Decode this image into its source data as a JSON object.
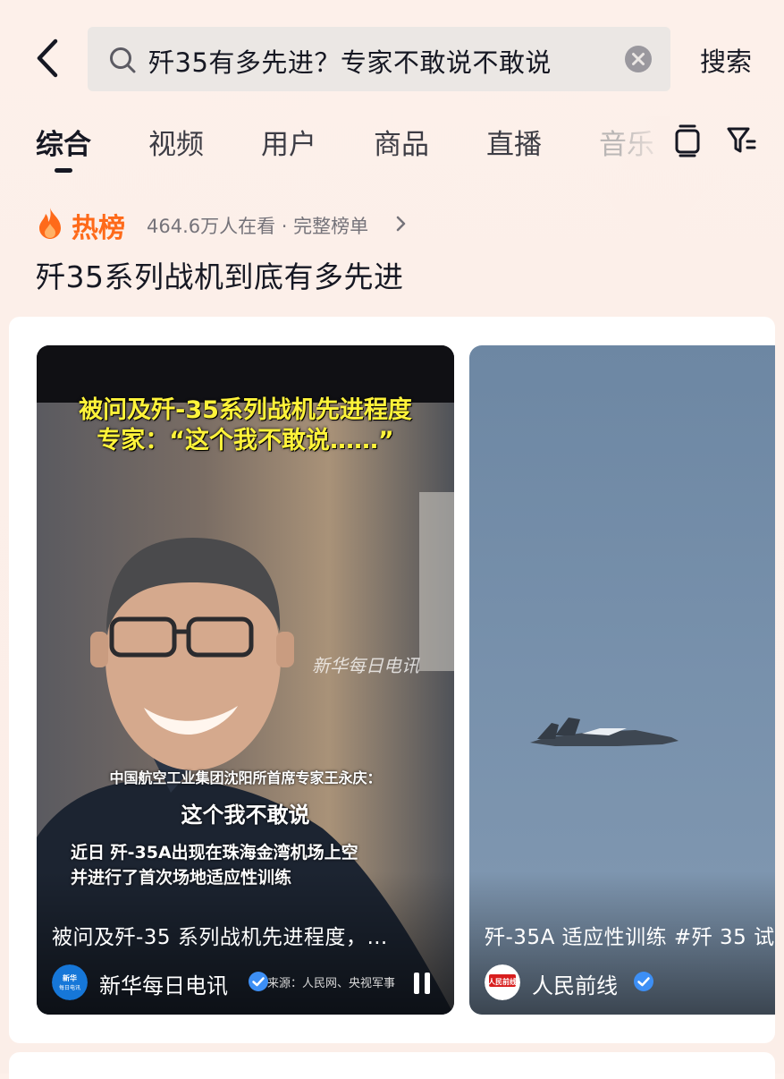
{
  "search": {
    "query": "歼35有多先进？专家不敢说不敢说",
    "button_label": "搜索"
  },
  "tabs": [
    {
      "label": "综合"
    },
    {
      "label": "视频"
    },
    {
      "label": "用户"
    },
    {
      "label": "商品"
    },
    {
      "label": "直播"
    },
    {
      "label": "音乐"
    }
  ],
  "hot": {
    "badge": "热榜",
    "meta": "464.6万人在看 · 完整榜单",
    "headline": "歼35系列战机到底有多先进"
  },
  "cards": [
    {
      "caption_top_1": "被问及歼-35系列战机先进程度",
      "caption_top_2": "专家：“这个我不敢说……”",
      "watermark": "新华每日电讯",
      "subtitle_1": "中国航空工业集团沈阳所首席专家王永庆：",
      "subtitle_2": "这个我不敢说",
      "subtitle_3": "近日 歼-35A出现在珠海金湾机场上空",
      "subtitle_4": "并进行了首次场地适应性训练",
      "title": "被问及歼-35 系列战机先进程度，…",
      "author": "新华每日电讯",
      "avatar_text": "新华每日电讯",
      "source": "来源：人民网、央视军事"
    },
    {
      "title": "歼-35A 适应性训练 #歼 35 试",
      "author": "人民前线",
      "avatar_text": "人民前线"
    }
  ],
  "colors": {
    "accent_hot": "#fe6a1a",
    "verified_blue": "#3d8ff5",
    "caption_yellow": "#fff33a"
  }
}
